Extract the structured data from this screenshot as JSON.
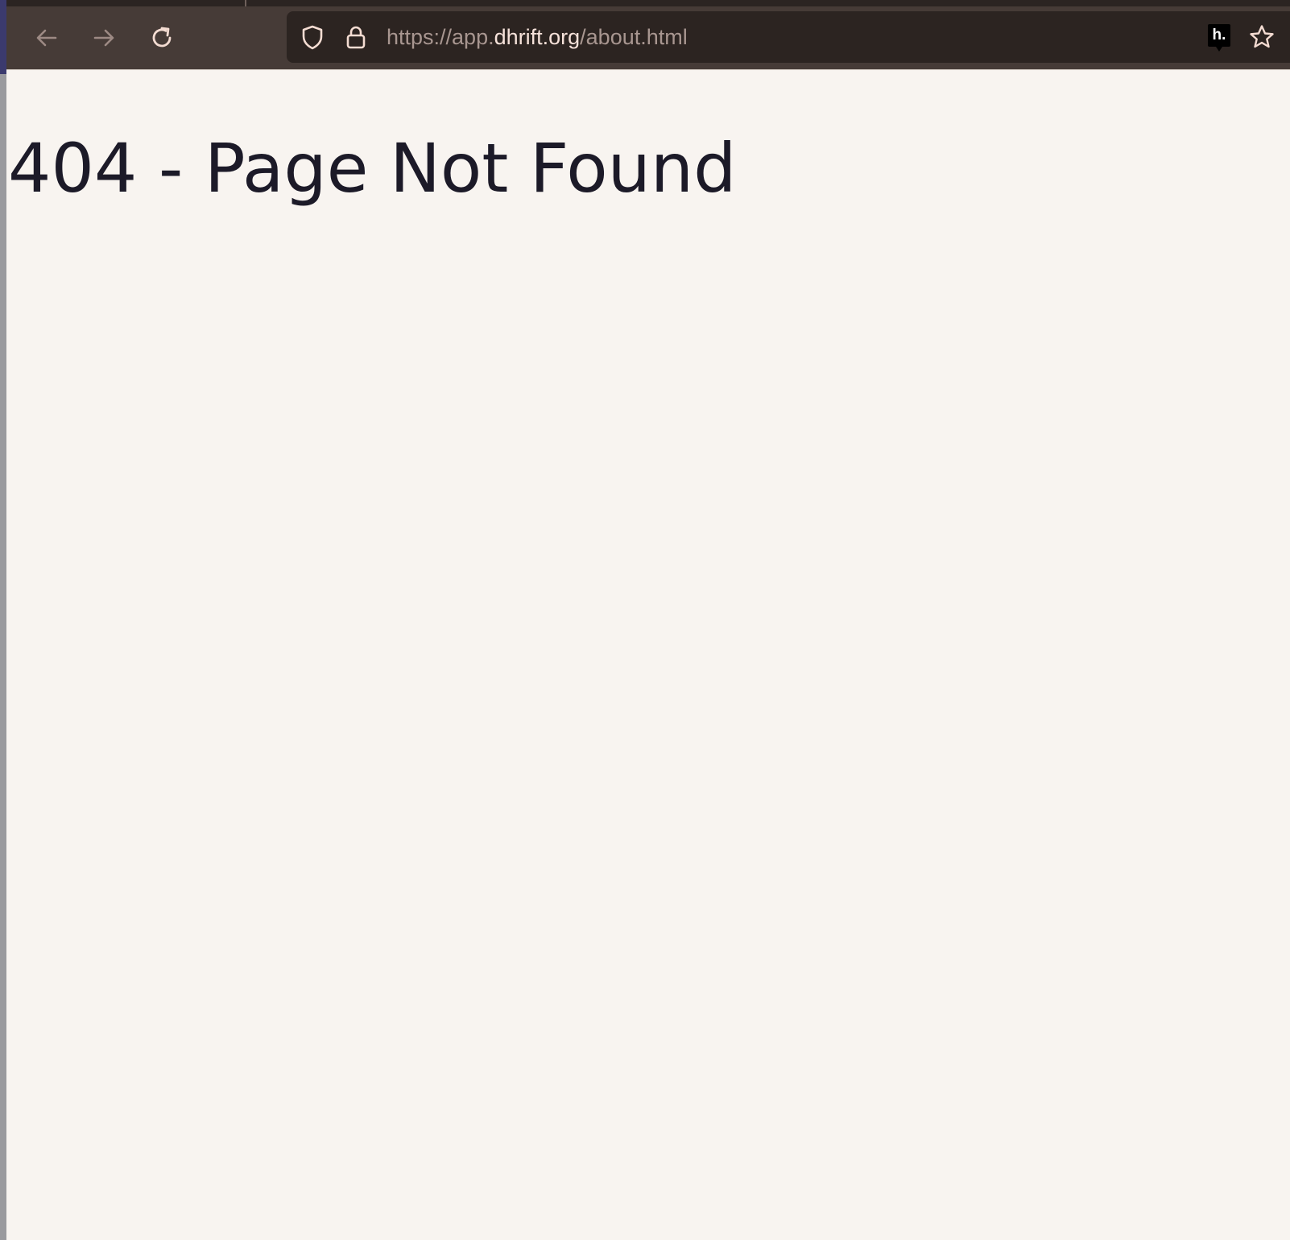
{
  "browser": {
    "nav": {
      "back_icon": "arrow-left-icon",
      "forward_icon": "arrow-right-icon",
      "reload_icon": "reload-icon"
    },
    "urlbar": {
      "shield_icon": "shield-icon",
      "lock_icon": "lock-icon",
      "url_prefix": "https://app.",
      "url_domain": "dhrift.org",
      "url_path": "/about.html",
      "extension_label": "h.",
      "bookmark_icon": "star-icon"
    },
    "colors": {
      "toolbar": "#463b37",
      "urlbar": "#2c2421",
      "page_background": "#f8f4f0",
      "heading": "#1c1a28"
    }
  },
  "page": {
    "title": "404 - Page Not Found"
  }
}
